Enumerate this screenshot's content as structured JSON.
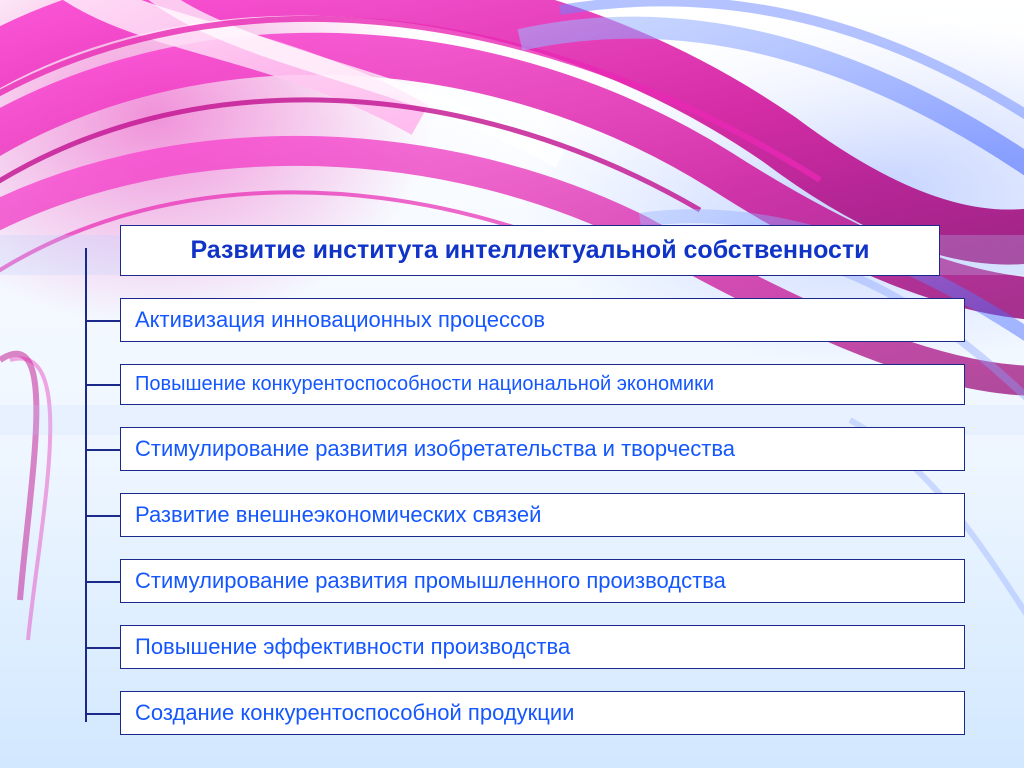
{
  "title": "Развитие института интеллектуальной собственности",
  "items": [
    "Активизация инновационных процессов",
    "Повышение конкурентоспособности национальной экономики",
    "Стимулирование развития изобретательства и творчества",
    "Развитие внешнеэкономических связей",
    "Стимулирование развития промышленного производства",
    "Повышение эффективности производства",
    "Создание конкурентоспособной продукции"
  ],
  "colors": {
    "text": "#1557ff",
    "title_text": "#1034c8",
    "border": "#1b2a8a",
    "accent_pink": "#e828b4",
    "accent_blue": "#5a78ff"
  }
}
